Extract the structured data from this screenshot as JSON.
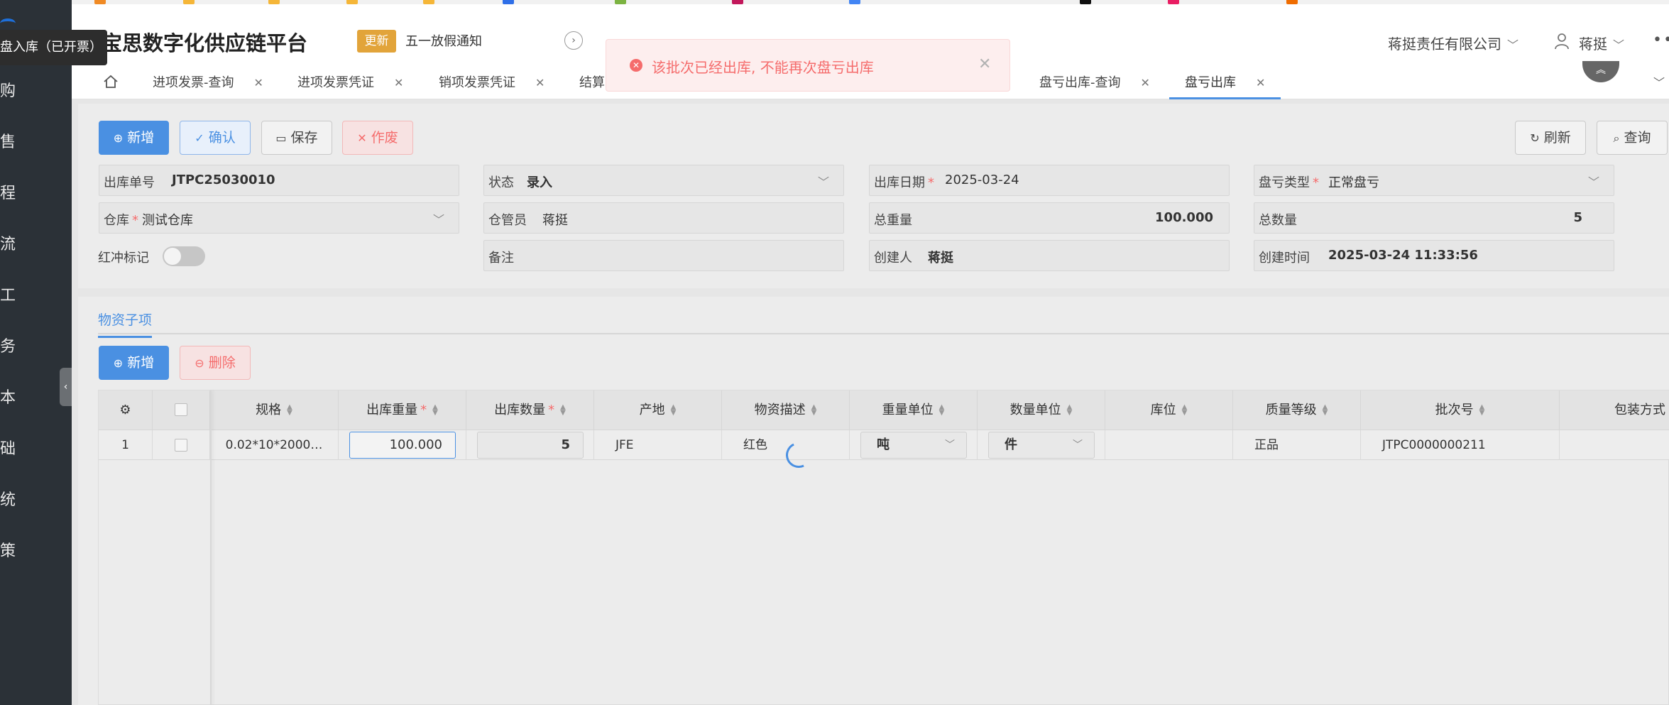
{
  "app": {
    "brand": "宝思数字化供应链平台",
    "update_badge": "更新",
    "notice": "五一放假通知",
    "company": "蒋挺责任有限公司",
    "user": "蒋挺",
    "more": "•••"
  },
  "sidebar": {
    "tooltip": "盘入库（已开票）",
    "items": [
      "购",
      "售",
      "程",
      "流",
      "工",
      "务",
      "本",
      "础",
      "统",
      "策"
    ]
  },
  "tabs": [
    {
      "label": "进项发票-查询"
    },
    {
      "label": "进项发票凭证"
    },
    {
      "label": "销项发票凭证"
    },
    {
      "label": "结算"
    },
    {
      "label": "盘亏出库-查询"
    },
    {
      "label": "盘亏出库"
    }
  ],
  "toast": {
    "message": "该批次已经出库, 不能再次盘亏出库",
    "status_color": "#f56c6c"
  },
  "toolbar": {
    "add": "新增",
    "confirm": "确认",
    "save": "保存",
    "void": "作废",
    "refresh": "刷新",
    "query": "查询"
  },
  "form": {
    "doc_no_label": "出库单号",
    "doc_no": "JTPC25030010",
    "status_label": "状态",
    "status": "录入",
    "date_label": "出库日期",
    "date": "2025-03-24",
    "loss_type_label": "盘亏类型",
    "loss_type": "正常盘亏",
    "warehouse_label": "仓库",
    "warehouse": "测试仓库",
    "keeper_label": "仓管员",
    "keeper": "蒋挺",
    "total_weight_label": "总重量",
    "total_weight": "100.000",
    "total_qty_label": "总数量",
    "total_qty": "5",
    "red_flag_label": "红冲标记",
    "remark_label": "备注",
    "remark": "",
    "creator_label": "创建人",
    "creator": "蒋挺",
    "created_at_label": "创建时间",
    "created_at": "2025-03-24 11:33:56"
  },
  "items": {
    "tab": "物资子项",
    "add": "新增",
    "delete": "删除",
    "columns": {
      "spec": "规格",
      "out_weight": "出库重量",
      "out_qty": "出库数量",
      "origin": "产地",
      "desc": "物资描述",
      "weight_unit": "重量单位",
      "qty_unit": "数量单位",
      "location": "库位",
      "quality": "质量等级",
      "batch": "批次号",
      "packing": "包装方式"
    },
    "rows": [
      {
        "index": "1",
        "spec": "0.02*10*2000…",
        "out_weight": "100.000",
        "out_qty": "5",
        "origin": "JFE",
        "desc": "红色",
        "weight_unit": "吨",
        "qty_unit": "件",
        "location": "",
        "quality": "正品",
        "batch": "JTPC0000000211",
        "packing": ""
      }
    ]
  },
  "colors": {
    "primary": "#4a90e2",
    "danger": "#f56c6c",
    "badge": "#e2a43a",
    "sidebar": "#2b3137"
  }
}
